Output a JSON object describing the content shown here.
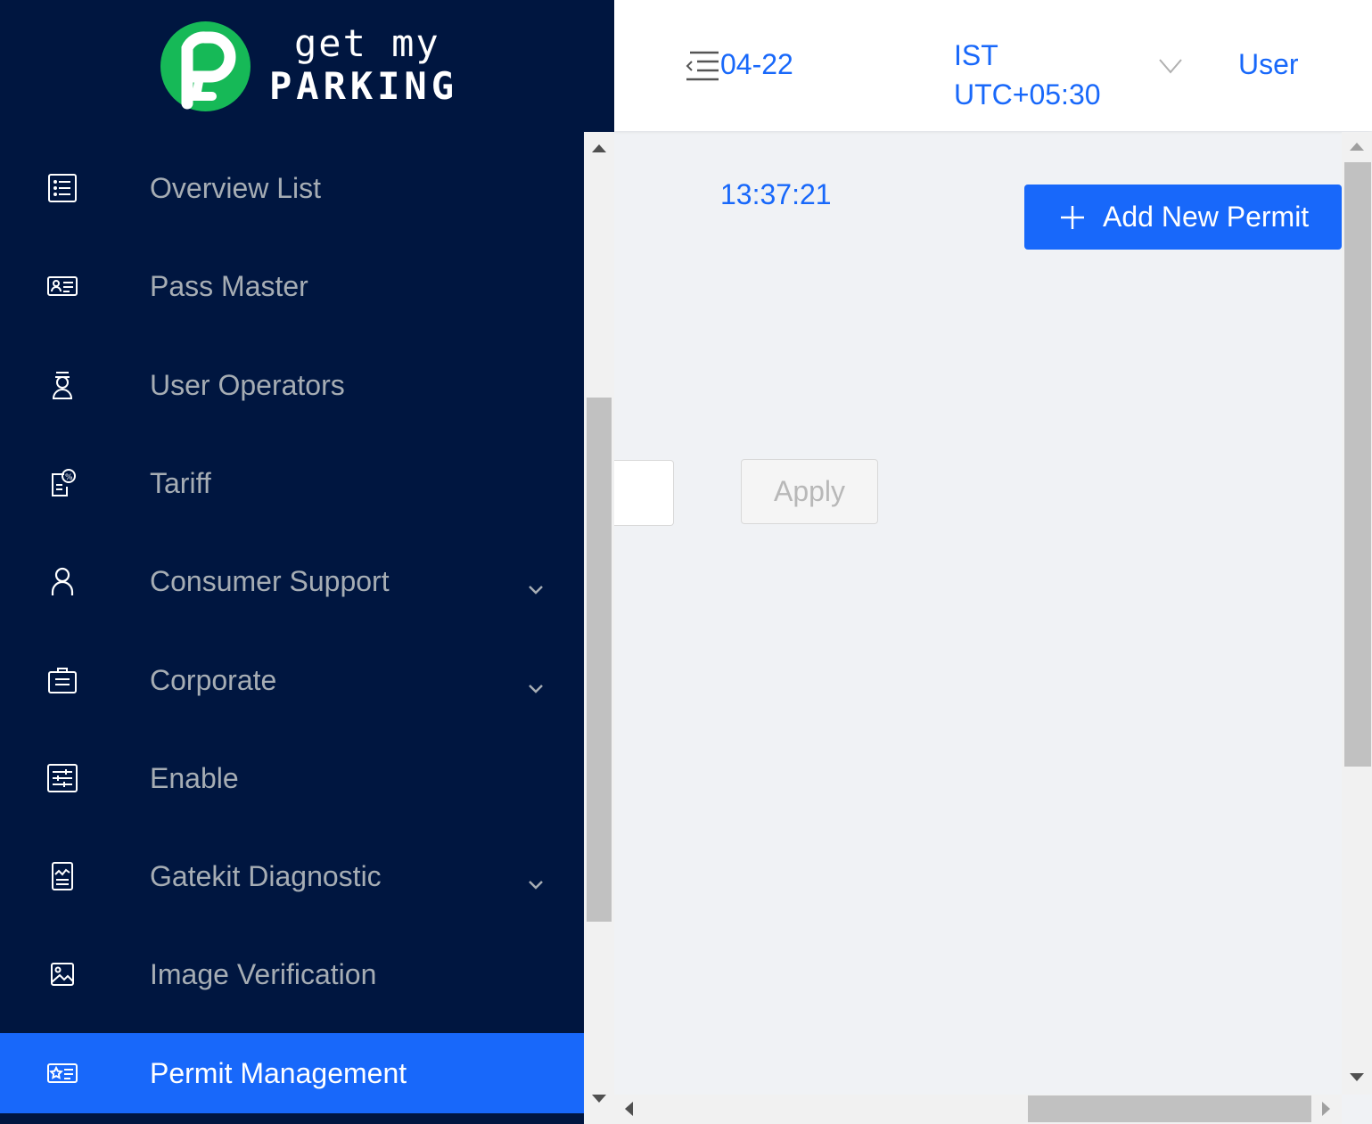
{
  "brand": {
    "line1": "get my",
    "line2": "PARKING"
  },
  "sidebar": {
    "items": [
      {
        "label": "Overview List",
        "icon": "list-icon",
        "has_submenu": false
      },
      {
        "label": "Pass Master",
        "icon": "id-card-icon",
        "has_submenu": false
      },
      {
        "label": "User Operators",
        "icon": "operator-icon",
        "has_submenu": false
      },
      {
        "label": "Tariff",
        "icon": "tariff-icon",
        "has_submenu": false
      },
      {
        "label": "Consumer Support",
        "icon": "user-icon",
        "has_submenu": true
      },
      {
        "label": "Corporate",
        "icon": "briefcase-icon",
        "has_submenu": true
      },
      {
        "label": "Enable",
        "icon": "sliders-icon",
        "has_submenu": false
      },
      {
        "label": "Gatekit Diagnostic",
        "icon": "diagnostic-icon",
        "has_submenu": true
      },
      {
        "label": "Image Verification",
        "icon": "image-icon",
        "has_submenu": false
      },
      {
        "label": "Permit Management",
        "icon": "permit-card-icon",
        "has_submenu": false,
        "active": true
      }
    ]
  },
  "header": {
    "date": "04-22",
    "timezone_line1": "IST",
    "timezone_line2": "UTC+05:30",
    "user_label": "User"
  },
  "main": {
    "time": "13:37:21",
    "add_button_label": "Add New Permit",
    "apply_button_label": "Apply"
  },
  "colors": {
    "sidebar_bg": "#001640",
    "accent": "#1868fa",
    "logo_green": "#16b957",
    "content_bg": "#f0f2f5"
  }
}
